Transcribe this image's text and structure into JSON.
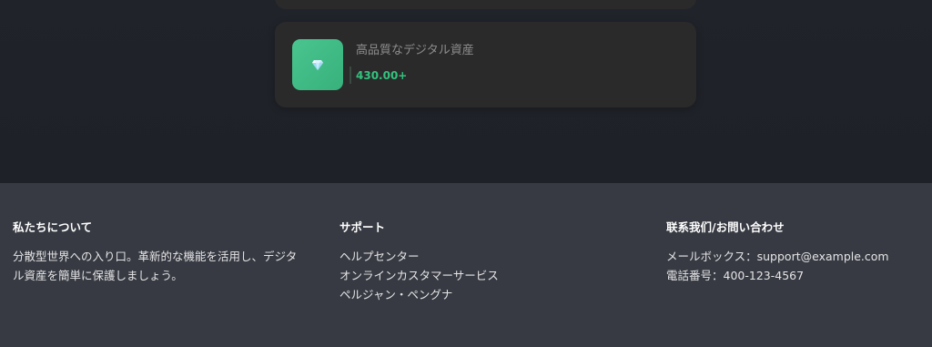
{
  "product": {
    "title": "高品質なデジタル資産",
    "price": "430.00+",
    "icon": "gem-icon"
  },
  "footer": {
    "about": {
      "heading": "私たちについて",
      "text": "分散型世界への入り口。革新的な機能を活用し、デジタル資産を簡単に保護しましょう。"
    },
    "support": {
      "heading": "サポート",
      "links": [
        "ヘルプセンター",
        "オンラインカスタマーサービス",
        "ペルジャン・ペングナ"
      ]
    },
    "contact": {
      "heading": "联系我们/お問い合わせ",
      "email": "メールボックス：support@example.com",
      "phone": "電話番号：400-123-4567"
    }
  },
  "colors": {
    "background": "#1f2228",
    "card": "#2a2a2a",
    "footer": "#373a42",
    "accent_green": "#34c27f"
  }
}
